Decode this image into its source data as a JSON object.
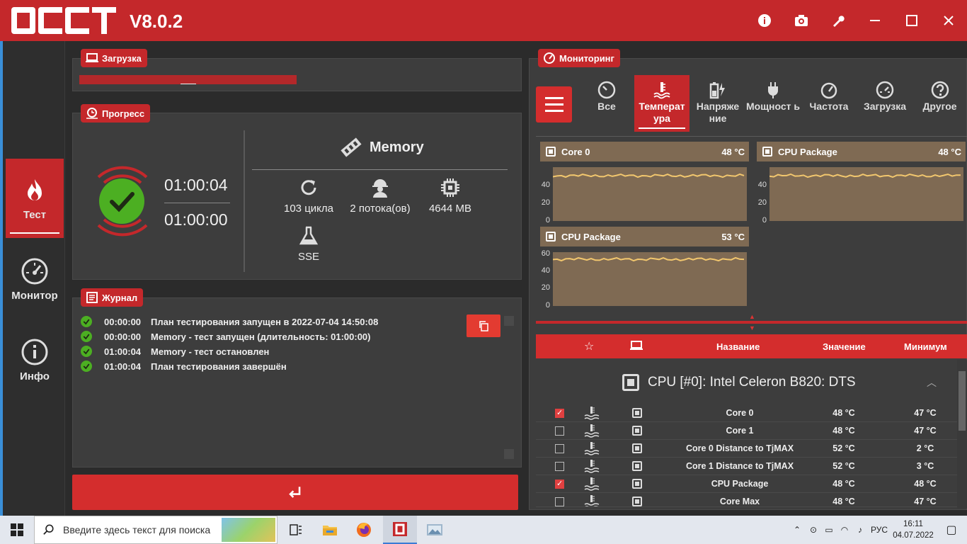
{
  "app": {
    "version": "V8.0.2"
  },
  "titlebar_icons": [
    "info-icon",
    "camera-icon",
    "wrench-icon",
    "minimize-icon",
    "maximize-icon",
    "close-icon"
  ],
  "sidebar": {
    "items": [
      {
        "label": "Тест",
        "icon": "flame-icon",
        "active": true
      },
      {
        "label": "Монитор",
        "icon": "gauge-icon",
        "active": false
      },
      {
        "label": "Инфо",
        "icon": "info-circle-icon",
        "active": false
      }
    ]
  },
  "load": {
    "title": "Загрузка"
  },
  "progress": {
    "title": "Прогресс",
    "elapsed": "01:00:04",
    "remaining": "01:00:00",
    "test_name": "Memory",
    "cycles": "103 цикла (ов)",
    "threads": "2 потока(ов)",
    "memory": "4644 MB",
    "instruction_set": "SSE"
  },
  "journal": {
    "title": "Журнал",
    "entries": [
      {
        "time": "00:00:00",
        "text": "План тестирования запущен в 2022-07-04 14:50:08"
      },
      {
        "time": "00:00:00",
        "text": "Memory - тест запущен (длительность: 01:00:00)"
      },
      {
        "time": "01:00:04",
        "text": "Memory - тест остановлен"
      },
      {
        "time": "01:00:04",
        "text": "План тестирования завершён"
      }
    ]
  },
  "monitoring": {
    "title": "Мониторинг",
    "tabs": [
      {
        "label": "Все",
        "icon": "all-gauge-icon"
      },
      {
        "label": "Температ ура",
        "icon": "thermometer-icon",
        "active": true
      },
      {
        "label": "Напряже ние",
        "icon": "battery-bolt-icon"
      },
      {
        "label": "Мощност ь",
        "icon": "plug-icon"
      },
      {
        "label": "Частота",
        "icon": "speedometer-icon"
      },
      {
        "label": "Загрузка",
        "icon": "load-gauge-icon"
      },
      {
        "label": "Другое",
        "icon": "question-icon"
      }
    ],
    "charts": [
      {
        "name": "Core 0",
        "value": "48 °C",
        "yticks": [
          "40",
          "20",
          "0"
        ]
      },
      {
        "name": "CPU Package",
        "value": "48 °C",
        "yticks": [
          "40",
          "20",
          "0"
        ]
      },
      {
        "name": "CPU Package",
        "value": "53 °C",
        "yticks": [
          "60",
          "40",
          "20",
          "0"
        ]
      }
    ],
    "table": {
      "headers": {
        "name": "Название",
        "value": "Значение",
        "min": "Минимум"
      },
      "group": "CPU [#0]: Intel Celeron B820: DTS",
      "rows": [
        {
          "checked": true,
          "name": "Core 0",
          "value": "48 °C",
          "min": "47 °C"
        },
        {
          "checked": false,
          "name": "Core 1",
          "value": "48 °C",
          "min": "47 °C"
        },
        {
          "checked": false,
          "name": "Core 0 Distance to TjMAX",
          "value": "52 °C",
          "min": "2 °C"
        },
        {
          "checked": false,
          "name": "Core 1 Distance to TjMAX",
          "value": "52 °C",
          "min": "3 °C"
        },
        {
          "checked": true,
          "name": "CPU Package",
          "value": "48 °C",
          "min": "48 °C"
        },
        {
          "checked": false,
          "name": "Core Max",
          "value": "48 °C",
          "min": "47 °C"
        }
      ]
    }
  },
  "taskbar": {
    "search_placeholder": "Введите здесь текст для поиска",
    "lang": "РУС",
    "time": "16:11",
    "date": "04.07.2022"
  },
  "colors": {
    "brand_red": "#c4282b",
    "ok_green": "#4caf22",
    "chart_bg": "#7f6a53",
    "chart_line": "#f2c76e"
  }
}
